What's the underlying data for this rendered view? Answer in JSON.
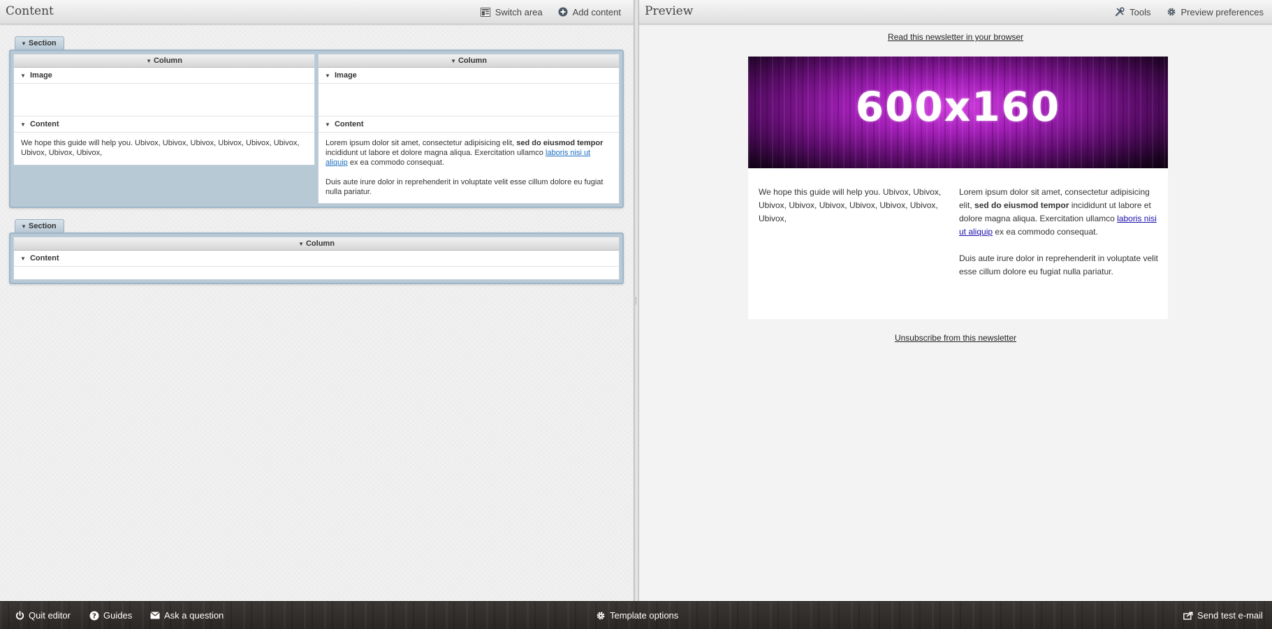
{
  "content_panel": {
    "title": "Content",
    "switch_area_label": "Switch area",
    "add_content_label": "Add content",
    "sections": [
      {
        "label": "Section",
        "columns": [
          {
            "label": "Column",
            "blocks": [
              {
                "label": "Image"
              },
              {
                "label": "Content",
                "text": "We hope this guide will help you. Ubivox, Ubivox, Ubivox, Ubivox, Ubivox, Ubivox, Ubivox, Ubivox, Ubivox,"
              }
            ]
          },
          {
            "label": "Column",
            "blocks": [
              {
                "label": "Image"
              },
              {
                "label": "Content",
                "p1_start": "Lorem ipsum dolor sit amet, consectetur adipisicing elit, ",
                "p1_bold": "sed do eiusmod tempor",
                "p1_mid": " incididunt ut labore et dolore magna aliqua. Exercitation ullamco ",
                "p1_link": "laboris nisi ut aliquip",
                "p1_end": " ex ea commodo consequat.",
                "p2": "Duis aute irure dolor in reprehenderit in voluptate velit esse cillum dolore eu fugiat nulla pariatur."
              }
            ]
          }
        ]
      },
      {
        "label": "Section",
        "columns": [
          {
            "label": "Column",
            "blocks": [
              {
                "label": "Content"
              }
            ]
          }
        ]
      }
    ]
  },
  "preview_panel": {
    "title": "Preview",
    "tools_label": "Tools",
    "preferences_label": "Preview preferences",
    "read_in_browser": "Read this newsletter in your browser",
    "banner_text": "600x160",
    "left_text": "We hope this guide will help you. Ubivox, Ubivox, Ubivox, Ubivox, Ubivox, Ubivox, Ubivox, Ubivox, Ubivox,",
    "right_p1_start": "Lorem ipsum dolor sit amet, consectetur adipisicing elit, ",
    "right_p1_bold": "sed do eiusmod tempor",
    "right_p1_mid": " incididunt ut labore et dolore magna aliqua. Exercitation ullamco ",
    "right_p1_link": "laboris nisi ut aliquip",
    "right_p1_end": " ex ea commodo consequat.",
    "right_p2": "Duis aute irure dolor in reprehenderit in voluptate velit esse cillum dolore eu fugiat nulla pariatur.",
    "unsubscribe": "Unsubscribe from this newsletter"
  },
  "footer": {
    "quit_label": "Quit editor",
    "guides_label": "Guides",
    "ask_label": "Ask a question",
    "template_options_label": "Template options",
    "send_test_label": "Send test e-mail"
  },
  "colors": {
    "section_bg": "#b8c9d6",
    "section_border": "#9eb6c8",
    "link": "#1c6fc0",
    "footer_bg": "#2f2b29"
  },
  "icons": {
    "switch_area": "layout-icon",
    "add_content": "plus-circle-icon",
    "tools": "tools-icon",
    "preferences": "gear-icon",
    "quit": "power-icon",
    "guides": "question-icon",
    "ask": "envelope-icon",
    "template_options": "gear-icon",
    "send_test": "send-icon"
  }
}
